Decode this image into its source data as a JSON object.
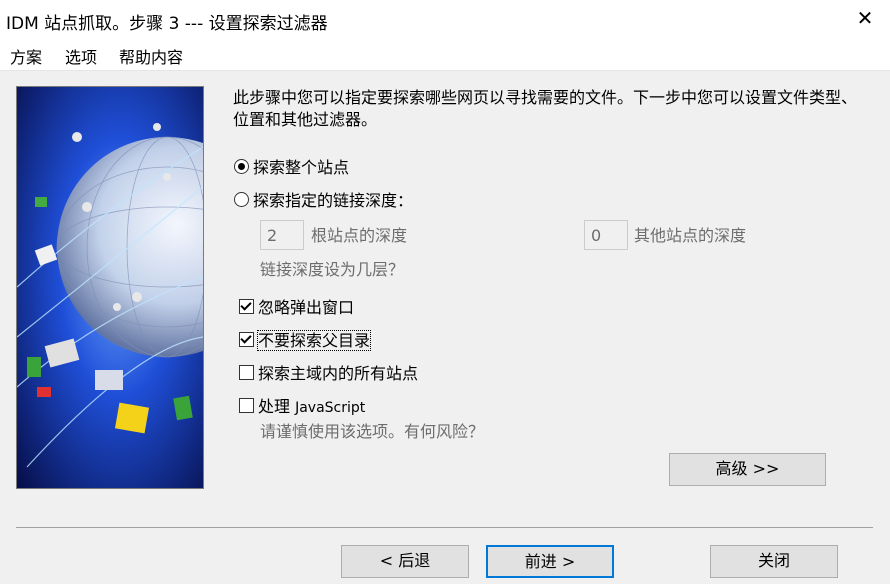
{
  "window": {
    "title": "IDM 站点抓取。步骤 3 --- 设置探索过滤器",
    "close_glyph": "✕"
  },
  "menu": [
    "方案",
    "选项",
    "帮助内容"
  ],
  "description": "此步骤中您可以指定要探索哪些网页以寻找需要的文件。下一步中您可以设置文件类型、位置和其他过滤器。",
  "scope": {
    "whole_site": {
      "label": "探索整个站点",
      "selected": true
    },
    "depth": {
      "label": "探索指定的链接深度：",
      "selected": false
    },
    "root_depth_value": "2",
    "root_depth_label": "根站点的深度",
    "other_depth_value": "0",
    "other_depth_label": "其他站点的深度",
    "depth_hint": "链接深度设为几层？"
  },
  "options": {
    "ignore_popups": {
      "label": "忽略弹出窗口",
      "checked": true
    },
    "no_parent": {
      "label": "不要探索父目录",
      "checked": true
    },
    "all_domain_sites": {
      "label": "探索主域内的所有站点",
      "checked": false
    },
    "javascript": {
      "label_prefix": "处理 ",
      "label_js": "JavaScript",
      "checked": false
    },
    "js_warning": "请谨慎使用该选项。有何风险？"
  },
  "buttons": {
    "advanced": "高级 >>",
    "back": "< 后退",
    "next": "前进 >",
    "close": "关闭"
  }
}
